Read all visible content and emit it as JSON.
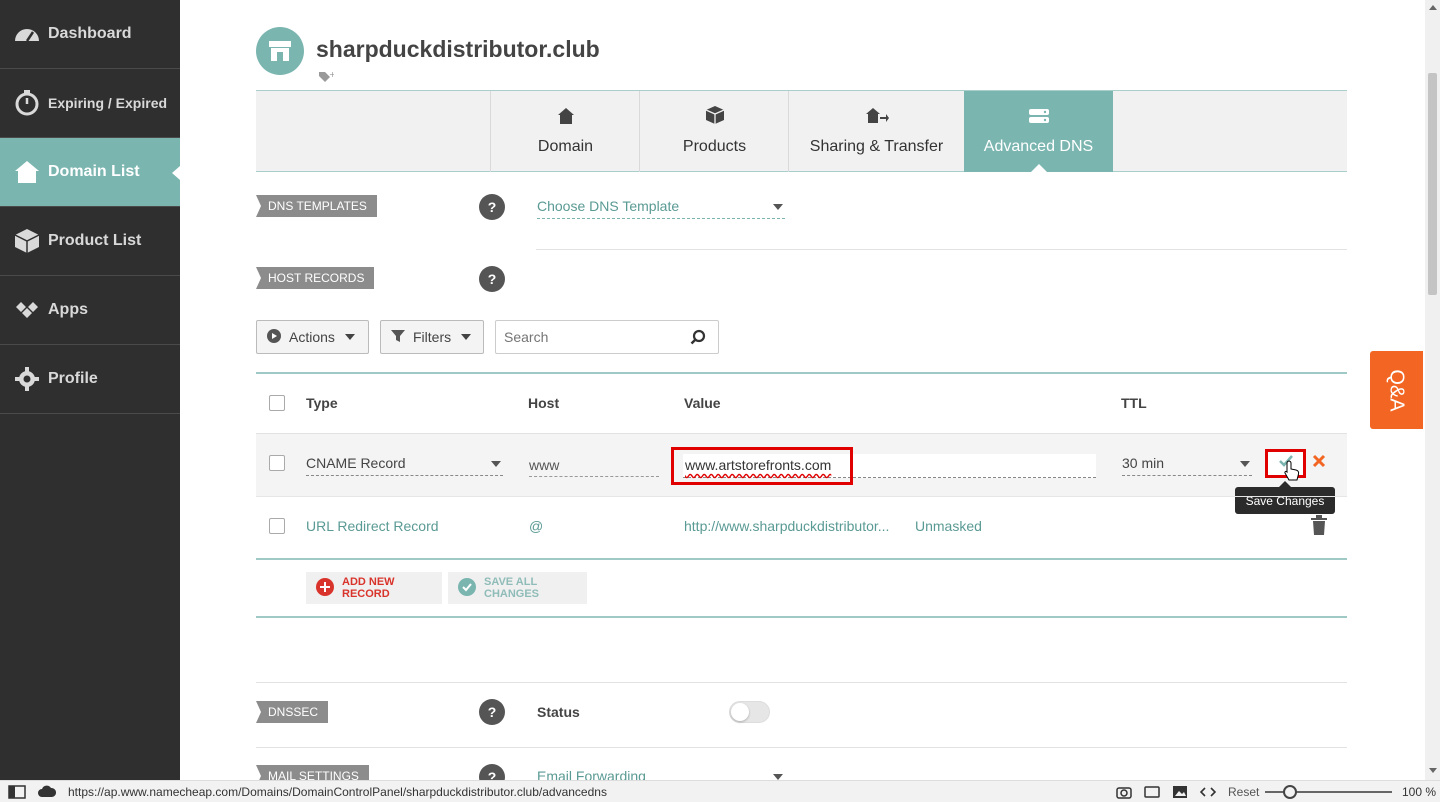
{
  "sidebar": {
    "items": [
      {
        "label": "Dashboard",
        "icon": "speedometer-icon"
      },
      {
        "label": "Expiring / Expired",
        "icon": "timer-icon"
      },
      {
        "label": "Domain List",
        "icon": "home-icon"
      },
      {
        "label": "Product List",
        "icon": "box-icon"
      },
      {
        "label": "Apps",
        "icon": "apps-icon"
      },
      {
        "label": "Profile",
        "icon": "gear-icon"
      }
    ]
  },
  "header": {
    "domain": "sharpduckdistributor.club"
  },
  "tabs": [
    {
      "label": "Domain",
      "icon": "home-icon"
    },
    {
      "label": "Products",
      "icon": "box-icon"
    },
    {
      "label": "Sharing & Transfer",
      "icon": "transfer-icon"
    },
    {
      "label": "Advanced DNS",
      "icon": "dns-server-icon"
    }
  ],
  "dns_templates": {
    "label": "DNS TEMPLATES",
    "help": "?",
    "select": "Choose DNS Template"
  },
  "host_records": {
    "label": "HOST RECORDS",
    "help": "?"
  },
  "toolbar": {
    "actions": "Actions",
    "filters": "Filters",
    "search_placeholder": "Search"
  },
  "table": {
    "headers": {
      "type": "Type",
      "host": "Host",
      "value": "Value",
      "ttl": "TTL"
    },
    "edit_row": {
      "type": "CNAME Record",
      "host": "www",
      "value": "www.artstorefronts.com",
      "ttl": "30 min"
    },
    "row2": {
      "type": "URL Redirect Record",
      "host": "@",
      "value": "http://www.sharpduckdistributor...",
      "mask": "Unmasked"
    }
  },
  "tooltip": "Save Changes",
  "add_new_record": "ADD NEW RECORD",
  "save_all_changes": "SAVE ALL CHANGES",
  "dnssec": {
    "label": "DNSSEC",
    "help": "?",
    "status_label": "Status"
  },
  "mail_settings": {
    "label": "MAIL SETTINGS",
    "help": "?",
    "select": "Email Forwarding"
  },
  "qa": "Q&A",
  "statusbar": {
    "url": "https://ap.www.namecheap.com/Domains/DomainControlPanel/sharpduckdistributor.club/advancedns",
    "reset": "Reset",
    "zoom": "100 %"
  },
  "colors": {
    "sidebar": "#2f2f2f",
    "accent": "#7ab5b0",
    "highlight": "#e00000",
    "qa": "#f26522"
  }
}
